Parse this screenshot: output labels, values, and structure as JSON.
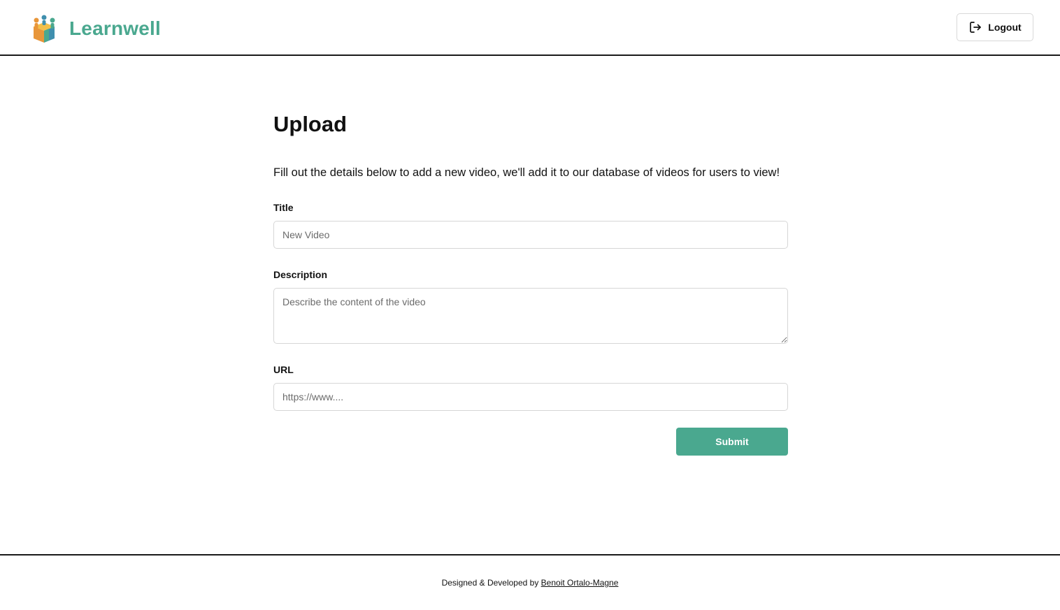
{
  "header": {
    "brand_name": "Learnwell",
    "logout_label": "Logout",
    "brand_color": "#4aa88f",
    "logo_icon": "cube-people-logo",
    "logout_icon": "logout-arrow-icon"
  },
  "main": {
    "title": "Upload",
    "description": "Fill out the details below to add a new video, we'll add it to our database of videos for users to view!",
    "form": {
      "title_label": "Title",
      "title_placeholder": "New Video",
      "title_value": "",
      "description_label": "Description",
      "description_placeholder": "Describe the content of the video",
      "description_value": "",
      "url_label": "URL",
      "url_placeholder": "https://www....",
      "url_value": "",
      "submit_label": "Submit",
      "submit_color": "#4aa88f"
    }
  },
  "footer": {
    "credit_prefix": "Designed & Developed by ",
    "author_name": "Benoit Ortalo-Magne"
  }
}
